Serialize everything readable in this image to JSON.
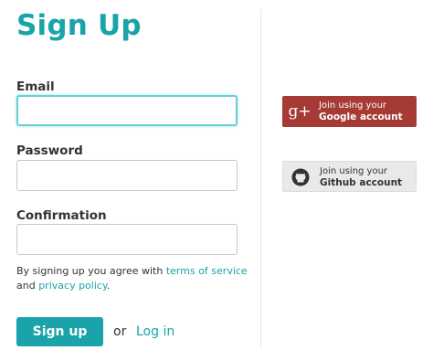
{
  "colors": {
    "accent": "#1aa3a8",
    "google": "#a63a34",
    "github_bg": "#e9e9e9"
  },
  "form": {
    "title": "Sign Up",
    "email_label": "Email",
    "email_value": "",
    "password_label": "Password",
    "password_value": "",
    "confirmation_label": "Confirmation",
    "confirmation_value": "",
    "terms_prefix": "By signing up you agree with ",
    "terms_link": "terms of service",
    "terms_and": "and ",
    "privacy_link": "privacy policy",
    "terms_suffix": ".",
    "submit_label": "Sign up",
    "or_text": "or",
    "login_label": "Log in"
  },
  "oauth": {
    "google": {
      "icon": "google-plus-icon",
      "icon_text": "g+",
      "line1": "Join using your",
      "line2": "Google account"
    },
    "github": {
      "icon": "github-icon",
      "line1": "Join using your",
      "line2": "Github account"
    }
  }
}
